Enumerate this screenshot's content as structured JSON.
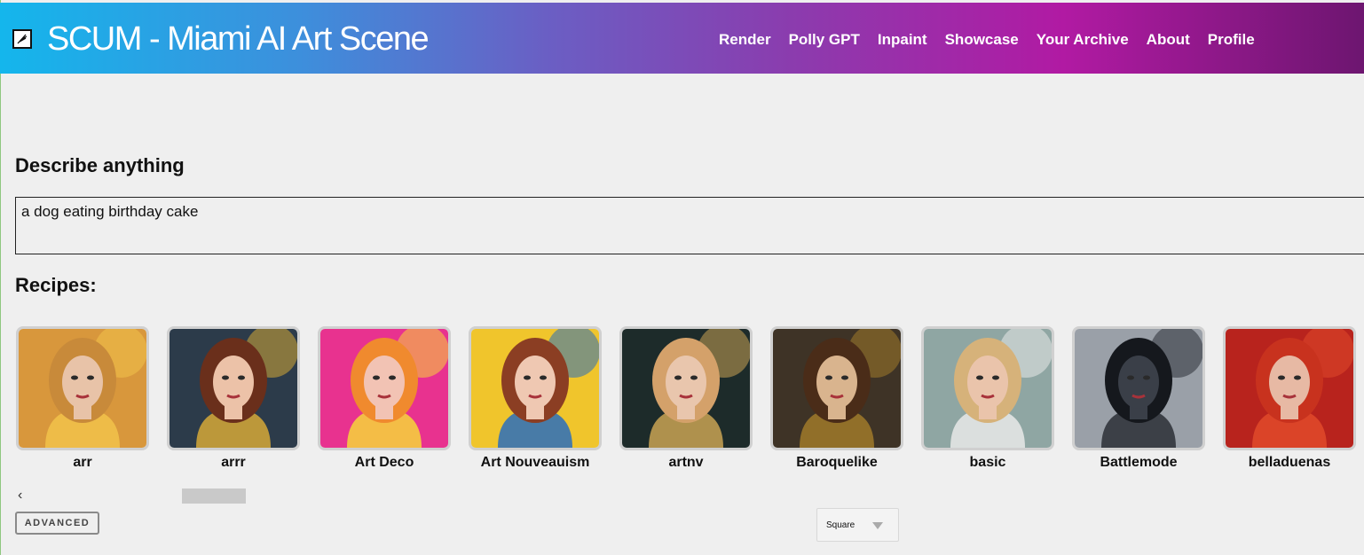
{
  "header": {
    "title": "SCUM - Miami AI Art Scene",
    "logo_icon": "feather-icon",
    "nav": [
      "Render",
      "Polly GPT",
      "Inpaint",
      "Showcase",
      "Your Archive",
      "About",
      "Profile"
    ]
  },
  "prompt": {
    "heading": "Describe anything",
    "value": "a dog eating birthday cake"
  },
  "recipes": {
    "heading": "Recipes:",
    "items": [
      {
        "label": "arr",
        "bg": "#d8973c",
        "accent": "#f2c24a",
        "hair": "#c88a3a",
        "skin": "#e8c3a8"
      },
      {
        "label": "arrr",
        "bg": "#2c3b4a",
        "accent": "#d6a937",
        "hair": "#6a2f1b",
        "skin": "#ecc2a8"
      },
      {
        "label": "Art Deco",
        "bg": "#e8328f",
        "accent": "#f6d63a",
        "hair": "#f08a2e",
        "skin": "#f2c3b4"
      },
      {
        "label": "Art Nouveauism",
        "bg": "#f0c52c",
        "accent": "#2a6dbd",
        "hair": "#8b3e23",
        "skin": "#efc8b2"
      },
      {
        "label": "artnv",
        "bg": "#1d2b2a",
        "accent": "#c9a354",
        "hair": "#d4a16a",
        "skin": "#e9c6ad"
      },
      {
        "label": "Baroquelike",
        "bg": "#3e3326",
        "accent": "#a07a2a",
        "hair": "#4a2c18",
        "skin": "#d9b48e"
      },
      {
        "label": "basic",
        "bg": "#8fa6a3",
        "accent": "#e9e9e9",
        "hair": "#d6b27a",
        "skin": "#eac4ab"
      },
      {
        "label": "Battlemode",
        "bg": "#9aa0a8",
        "accent": "#2b2f36",
        "hair": "#15181d",
        "skin": "#3a3f48"
      },
      {
        "label": "belladuenas",
        "bg": "#b8231d",
        "accent": "#e04a2a",
        "hair": "#c8321e",
        "skin": "#e7b9a4"
      }
    ]
  },
  "controls": {
    "advanced_label": "ADVANCED",
    "scroll_left_icon": "chevron-left-icon",
    "aspect_select": "Square",
    "aspect_arrow_icon": "caret-down-icon"
  }
}
